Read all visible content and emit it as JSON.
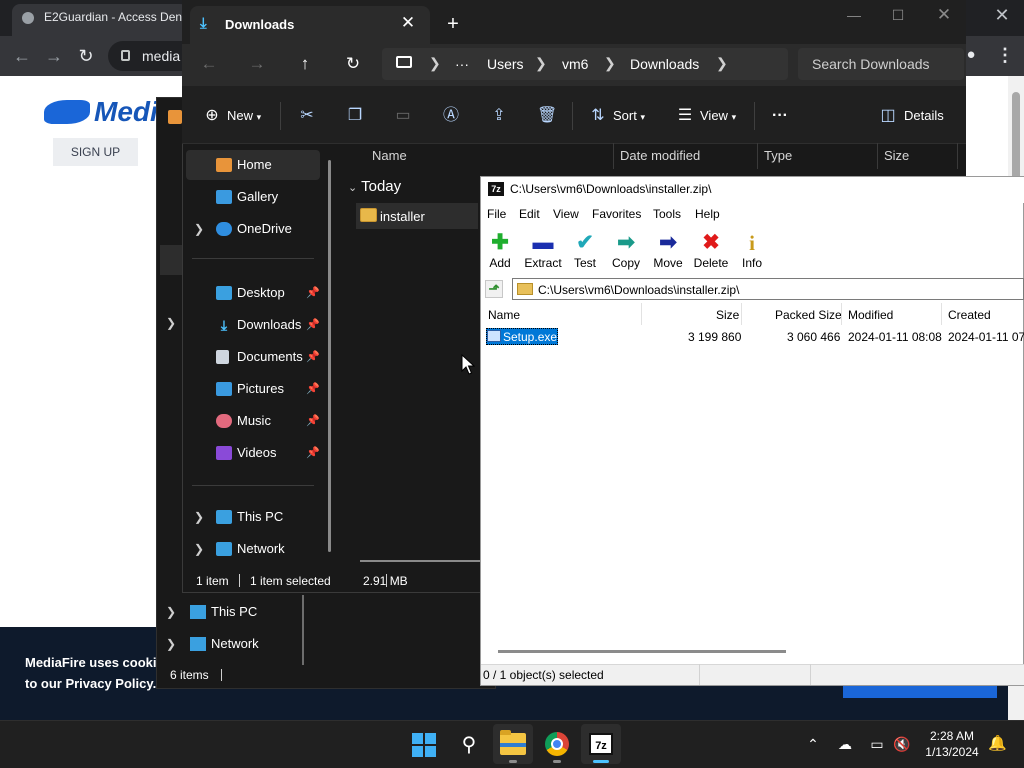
{
  "colors": {
    "explorer_bg": "#191919",
    "explorer_accent": "#4cc2ff",
    "sevenzip_selection": "#0078d7",
    "mediafire_blue": "#1a66d8",
    "cookie_banner": "#0e1a2c"
  },
  "chrome": {
    "tab_title": "E2Guardian - Access Denie",
    "omnibox_text": "media",
    "icons": [
      "back-arrow-icon",
      "forward-arrow-icon",
      "reload-icon",
      "lock-icon",
      "profile-icon",
      "kebab-menu-icon"
    ]
  },
  "webpage": {
    "logo_text": "Medi",
    "signup_label": "SIGN UP",
    "cookie_line1": "MediaFire uses cookie",
    "cookie_line2_prefix": "to our ",
    "cookie_link": "Privacy Policy",
    "cookie_line2_suffix": ".."
  },
  "explorer2": {
    "nav": [
      {
        "label": "This PC",
        "icon": "monitor-icon"
      },
      {
        "label": "Network",
        "icon": "network-icon"
      }
    ],
    "status_items": "6 items"
  },
  "explorer": {
    "tab_title": "Downloads",
    "new_tab_glyph": "+",
    "breadcrumb": [
      "Users",
      "vm6",
      "Downloads"
    ],
    "breadcrumb_more": "···",
    "search_placeholder": "Search Downloads",
    "commands": {
      "new": "New",
      "sort": "Sort",
      "view": "View",
      "details": "Details",
      "more": "···"
    },
    "nav": {
      "home": "Home",
      "gallery": "Gallery",
      "onedrive": "OneDrive",
      "desktop": "Desktop",
      "downloads": "Downloads",
      "documents": "Documents",
      "pictures": "Pictures",
      "music": "Music",
      "videos": "Videos",
      "thispc": "This PC",
      "network": "Network"
    },
    "columns": [
      "Name",
      "Date modified",
      "Type",
      "Size"
    ],
    "group_label": "Today",
    "files": [
      {
        "name": "installer",
        "icon": "zip-folder-icon"
      }
    ],
    "status": {
      "count": "1 item",
      "selected": "1 item selected",
      "size": "2.91 MB"
    }
  },
  "sevenzip": {
    "title": "C:\\Users\\vm6\\Downloads\\installer.zip\\",
    "app_icon_text": "7z",
    "menu": [
      "File",
      "Edit",
      "View",
      "Favorites",
      "Tools",
      "Help"
    ],
    "toolbar": [
      {
        "label": "Add",
        "icon": "plus-icon",
        "color": "#1fae2e"
      },
      {
        "label": "Extract",
        "icon": "minus-icon",
        "color": "#1a2fb0"
      },
      {
        "label": "Test",
        "icon": "check-icon",
        "color": "#20a8b8"
      },
      {
        "label": "Copy",
        "icon": "double-arrow-icon",
        "color": "#1a9a8a"
      },
      {
        "label": "Move",
        "icon": "arrow-right-icon",
        "color": "#1a2a9a"
      },
      {
        "label": "Delete",
        "icon": "cross-icon",
        "color": "#e01a1a"
      },
      {
        "label": "Info",
        "icon": "info-icon",
        "color": "#c89a1a"
      }
    ],
    "address": "C:\\Users\\vm6\\Downloads\\installer.zip\\",
    "columns": [
      "Name",
      "Size",
      "Packed Size",
      "Modified",
      "Created"
    ],
    "rows": [
      {
        "name": "Setup.exe",
        "size": "3 199 860",
        "packed": "3 060 466",
        "modified": "2024-01-11 08:08",
        "created": "2024-01-11 07:"
      }
    ],
    "status": "0 / 1 object(s) selected"
  },
  "taskbar": {
    "apps": [
      "windows-start-icon",
      "search-icon",
      "file-explorer-icon",
      "chrome-icon",
      "sevenzip-icon"
    ],
    "sevenzip_text": "7z",
    "time": "2:28 AM",
    "date": "1/13/2024"
  }
}
